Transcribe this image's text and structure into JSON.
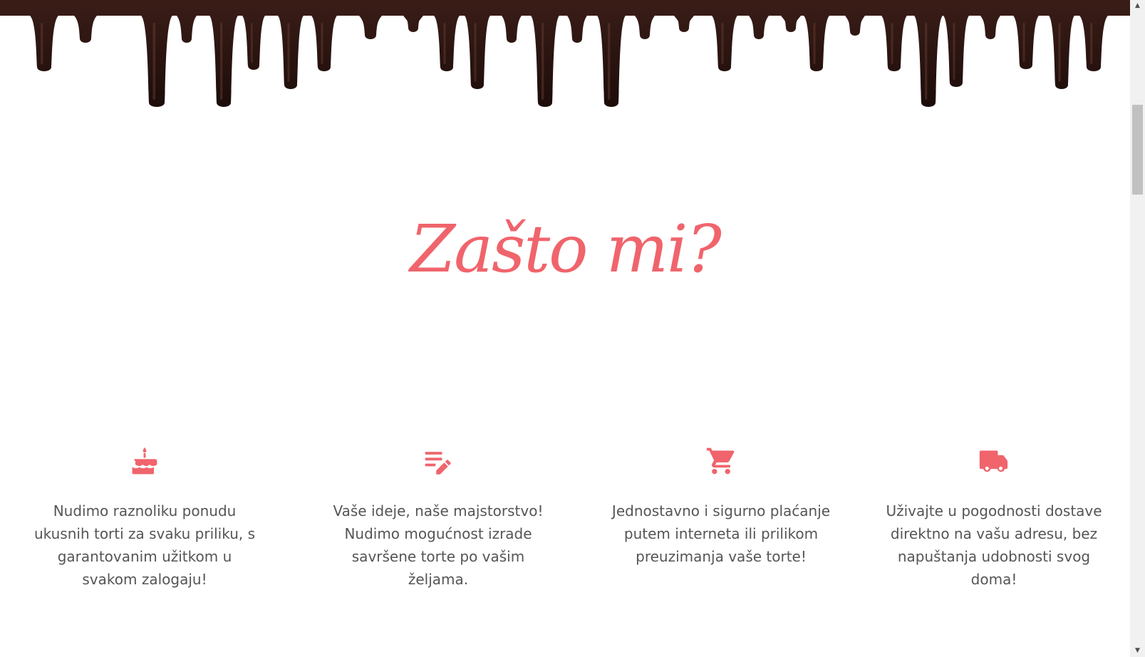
{
  "colors": {
    "accent": "#f0646c",
    "chocolate": "#2a1411",
    "text": "#555555"
  },
  "section": {
    "title": "Zašto mi?"
  },
  "features": [
    {
      "icon": "cake-icon",
      "text": "Nudimo raznoliku ponudu ukusnih torti za svaku priliku, s garantovanim užitkom u svakom zalogaju!"
    },
    {
      "icon": "edit-list-icon",
      "text": "Vaše ideje, naše majstorstvo! Nudimo mogućnost izrade savršene torte po vašim željama."
    },
    {
      "icon": "shopping-cart-icon",
      "text": "Jednostavno i sigurno plaćanje putem interneta ili prilikom preuzimanja vaše torte!"
    },
    {
      "icon": "delivery-truck-icon",
      "text": "Uživajte u pogodnosti dostave direktno na vašu adresu, bez napuštanja udobnosti svog doma!"
    }
  ],
  "scrollbar": {
    "up_glyph": "▲",
    "down_glyph": "▼"
  }
}
